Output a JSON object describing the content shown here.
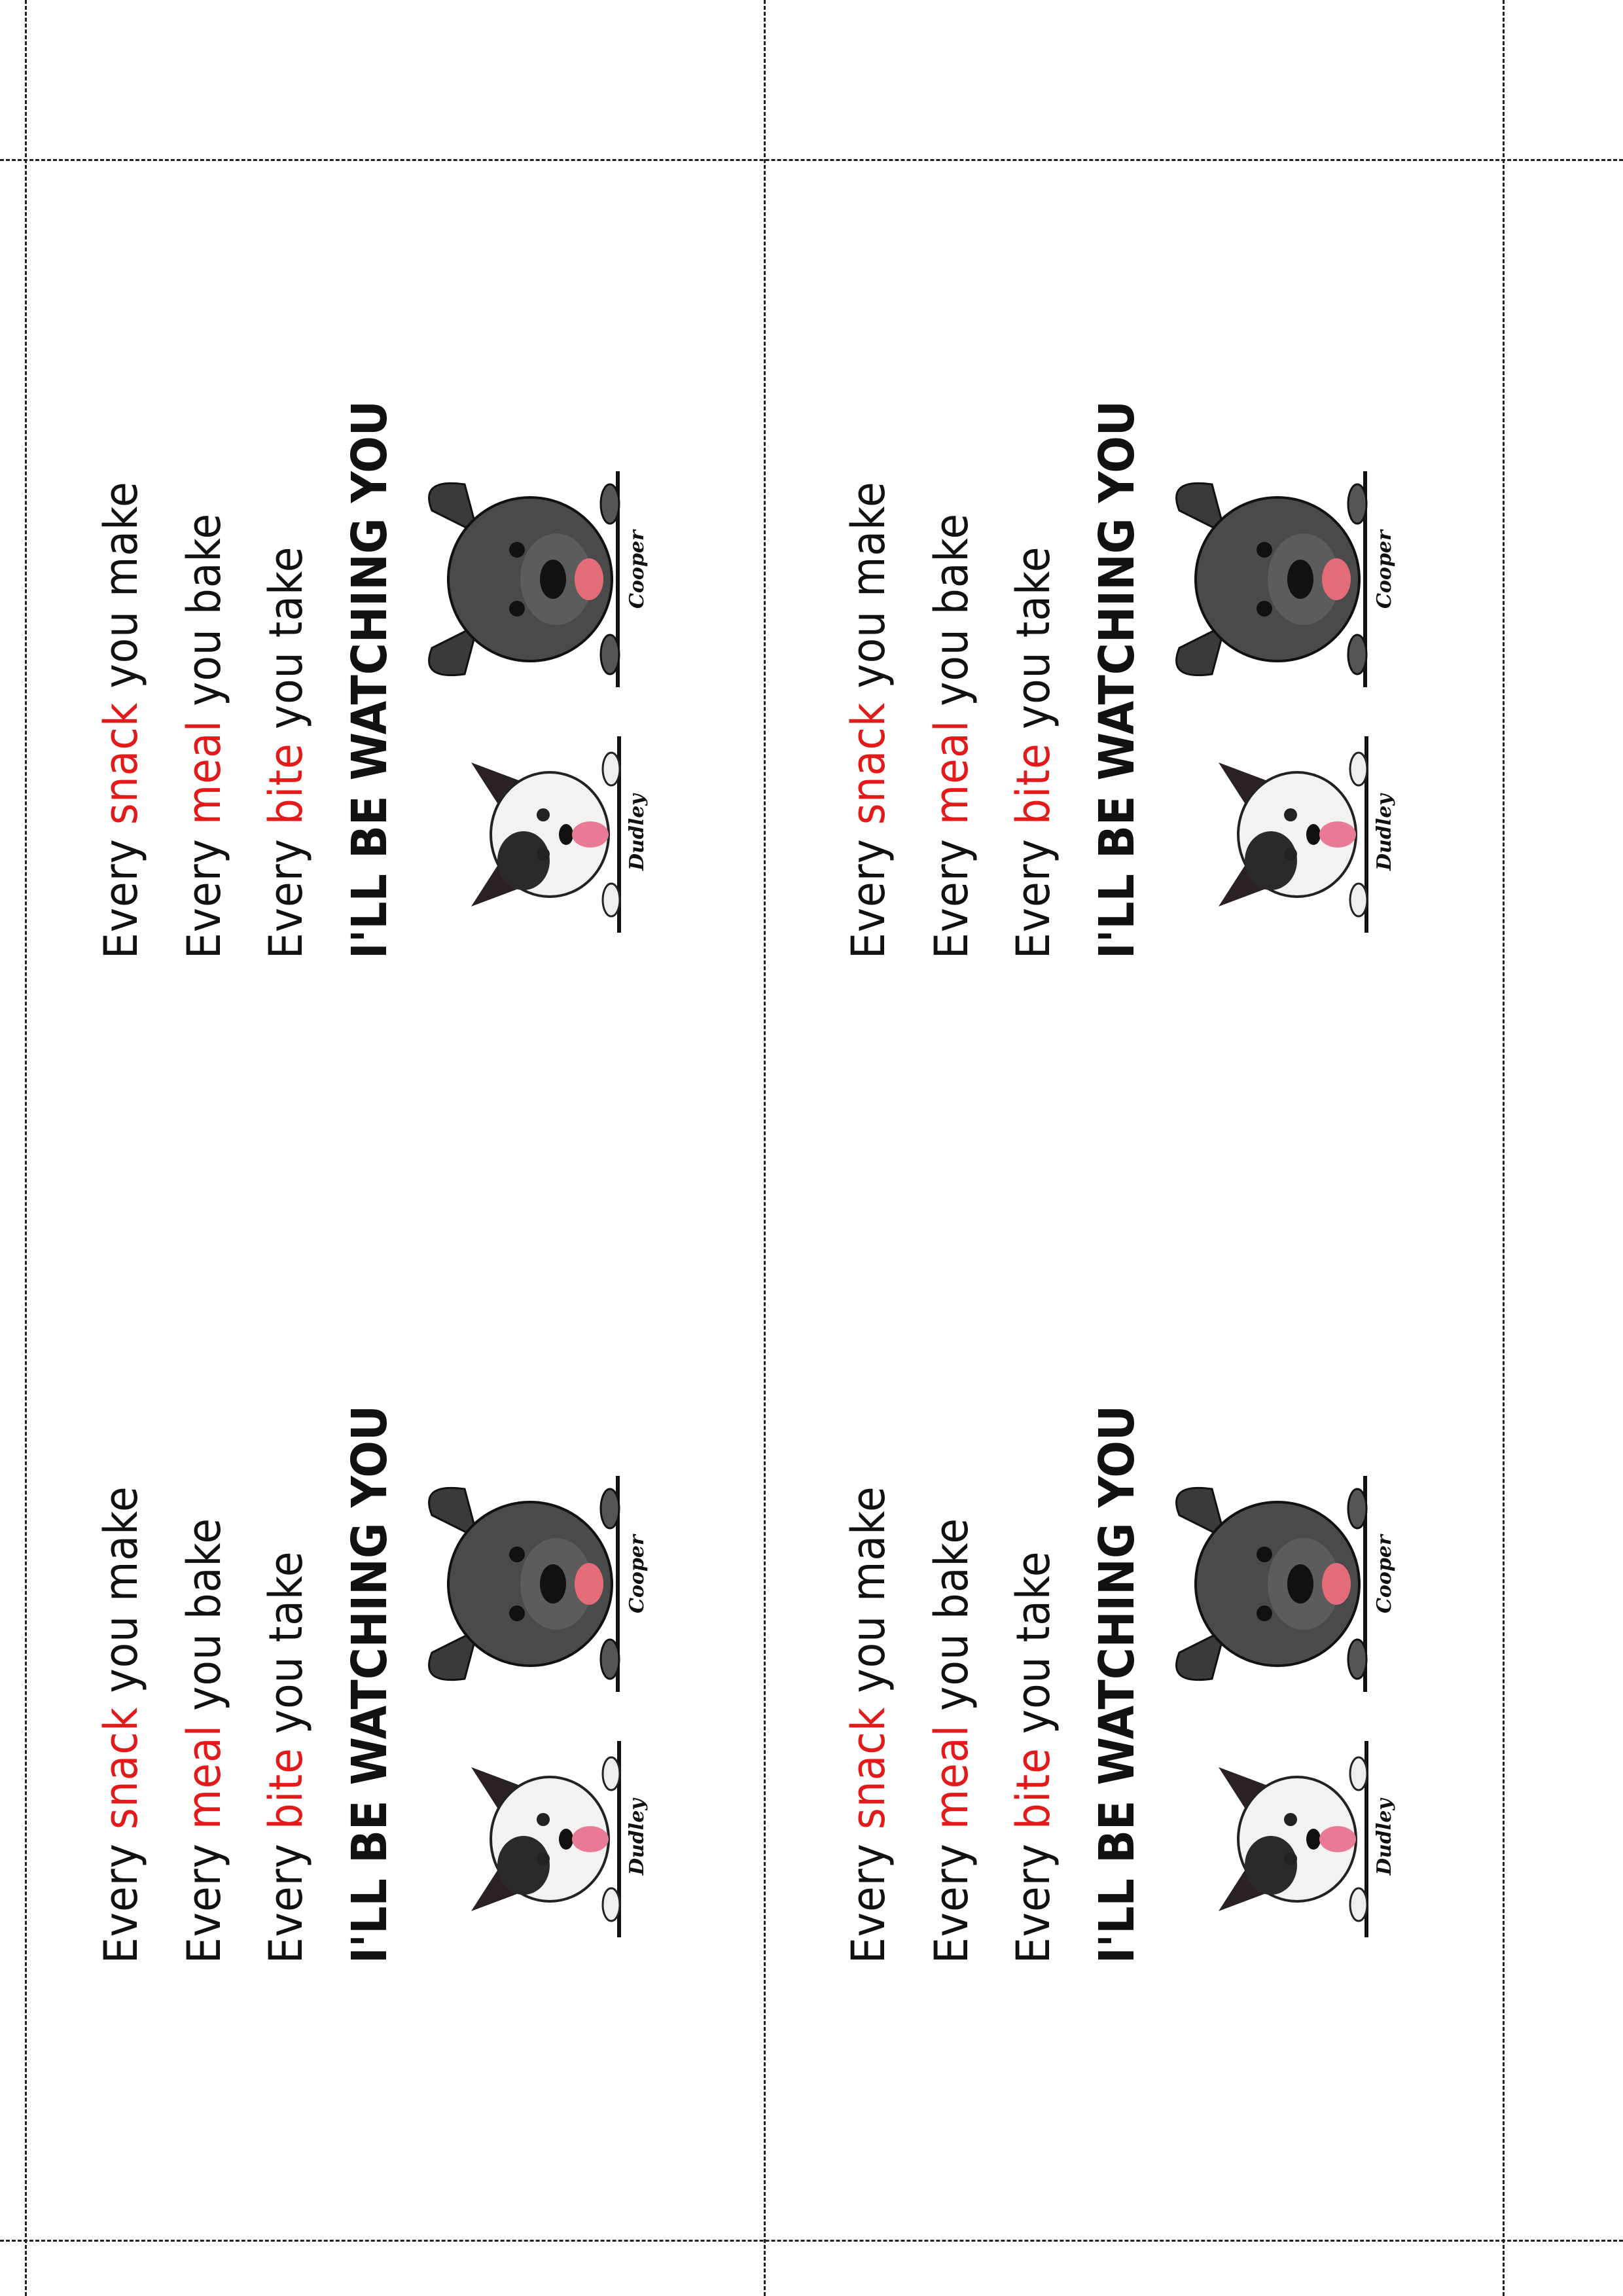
{
  "lines": {
    "line1_prefix": "Every ",
    "line1_highlight": "snack",
    "line1_suffix": " you make",
    "line2_prefix": "Every ",
    "line2_highlight": "meal",
    "line2_suffix": " you bake",
    "line3_prefix": "Every ",
    "line3_highlight": "bite",
    "line3_suffix": " you take",
    "line4": "I'LL BE WATCHING YOU"
  },
  "dogs": {
    "left_name": "Dudley",
    "right_name": "Cooper"
  },
  "colors": {
    "highlight": "#e21a1a",
    "text": "#111111",
    "cut_line": "#222222"
  }
}
